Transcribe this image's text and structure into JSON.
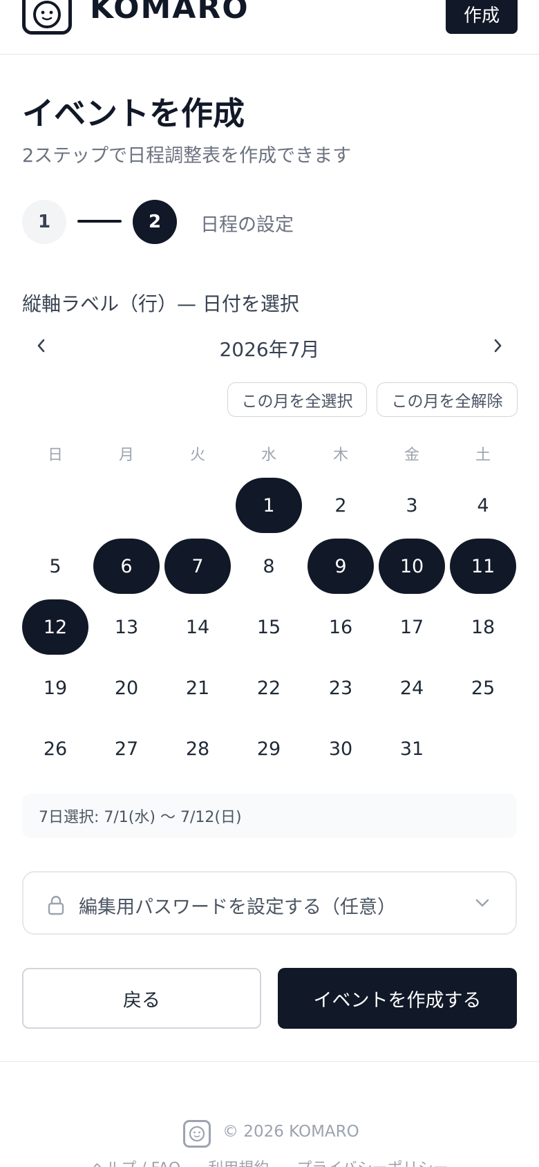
{
  "header": {
    "logo_text": "KOMARO",
    "create_button": "作成"
  },
  "page": {
    "title": "イベントを作成",
    "subtitle": "2ステップで日程調整表を作成できます"
  },
  "stepper": {
    "step1": "1",
    "step2": "2",
    "current_label": "日程の設定"
  },
  "calendar": {
    "section_label": "縦軸ラベル（行）— 日付を選択",
    "month_label": "2026年7月",
    "select_all": "この月を全選択",
    "clear_all": "この月を全解除",
    "weekdays": [
      "日",
      "月",
      "火",
      "水",
      "木",
      "金",
      "土"
    ],
    "first_weekday_index": 3,
    "days_in_month": 31,
    "selected_days": [
      1,
      6,
      7,
      9,
      10,
      11,
      12
    ]
  },
  "summary": {
    "text": "7日選択: 7/1(水) 〜 7/12(日)"
  },
  "password": {
    "label": "編集用パスワードを設定する（任意）"
  },
  "actions": {
    "back": "戻る",
    "submit": "イベントを作成する"
  },
  "footer": {
    "copyright": "© 2026 KOMARO",
    "links": [
      "ヘルプ / FAQ",
      "利用規約",
      "プライバシーポリシー"
    ]
  },
  "colors": {
    "primary": "#111827",
    "muted": "#6b7280",
    "border": "#e5e7eb"
  },
  "icons": {
    "prev": "chevron-left-icon",
    "next": "chevron-right-icon",
    "lock": "lock-icon",
    "expand": "chevron-down-icon",
    "logo": "smiley-face-icon"
  }
}
